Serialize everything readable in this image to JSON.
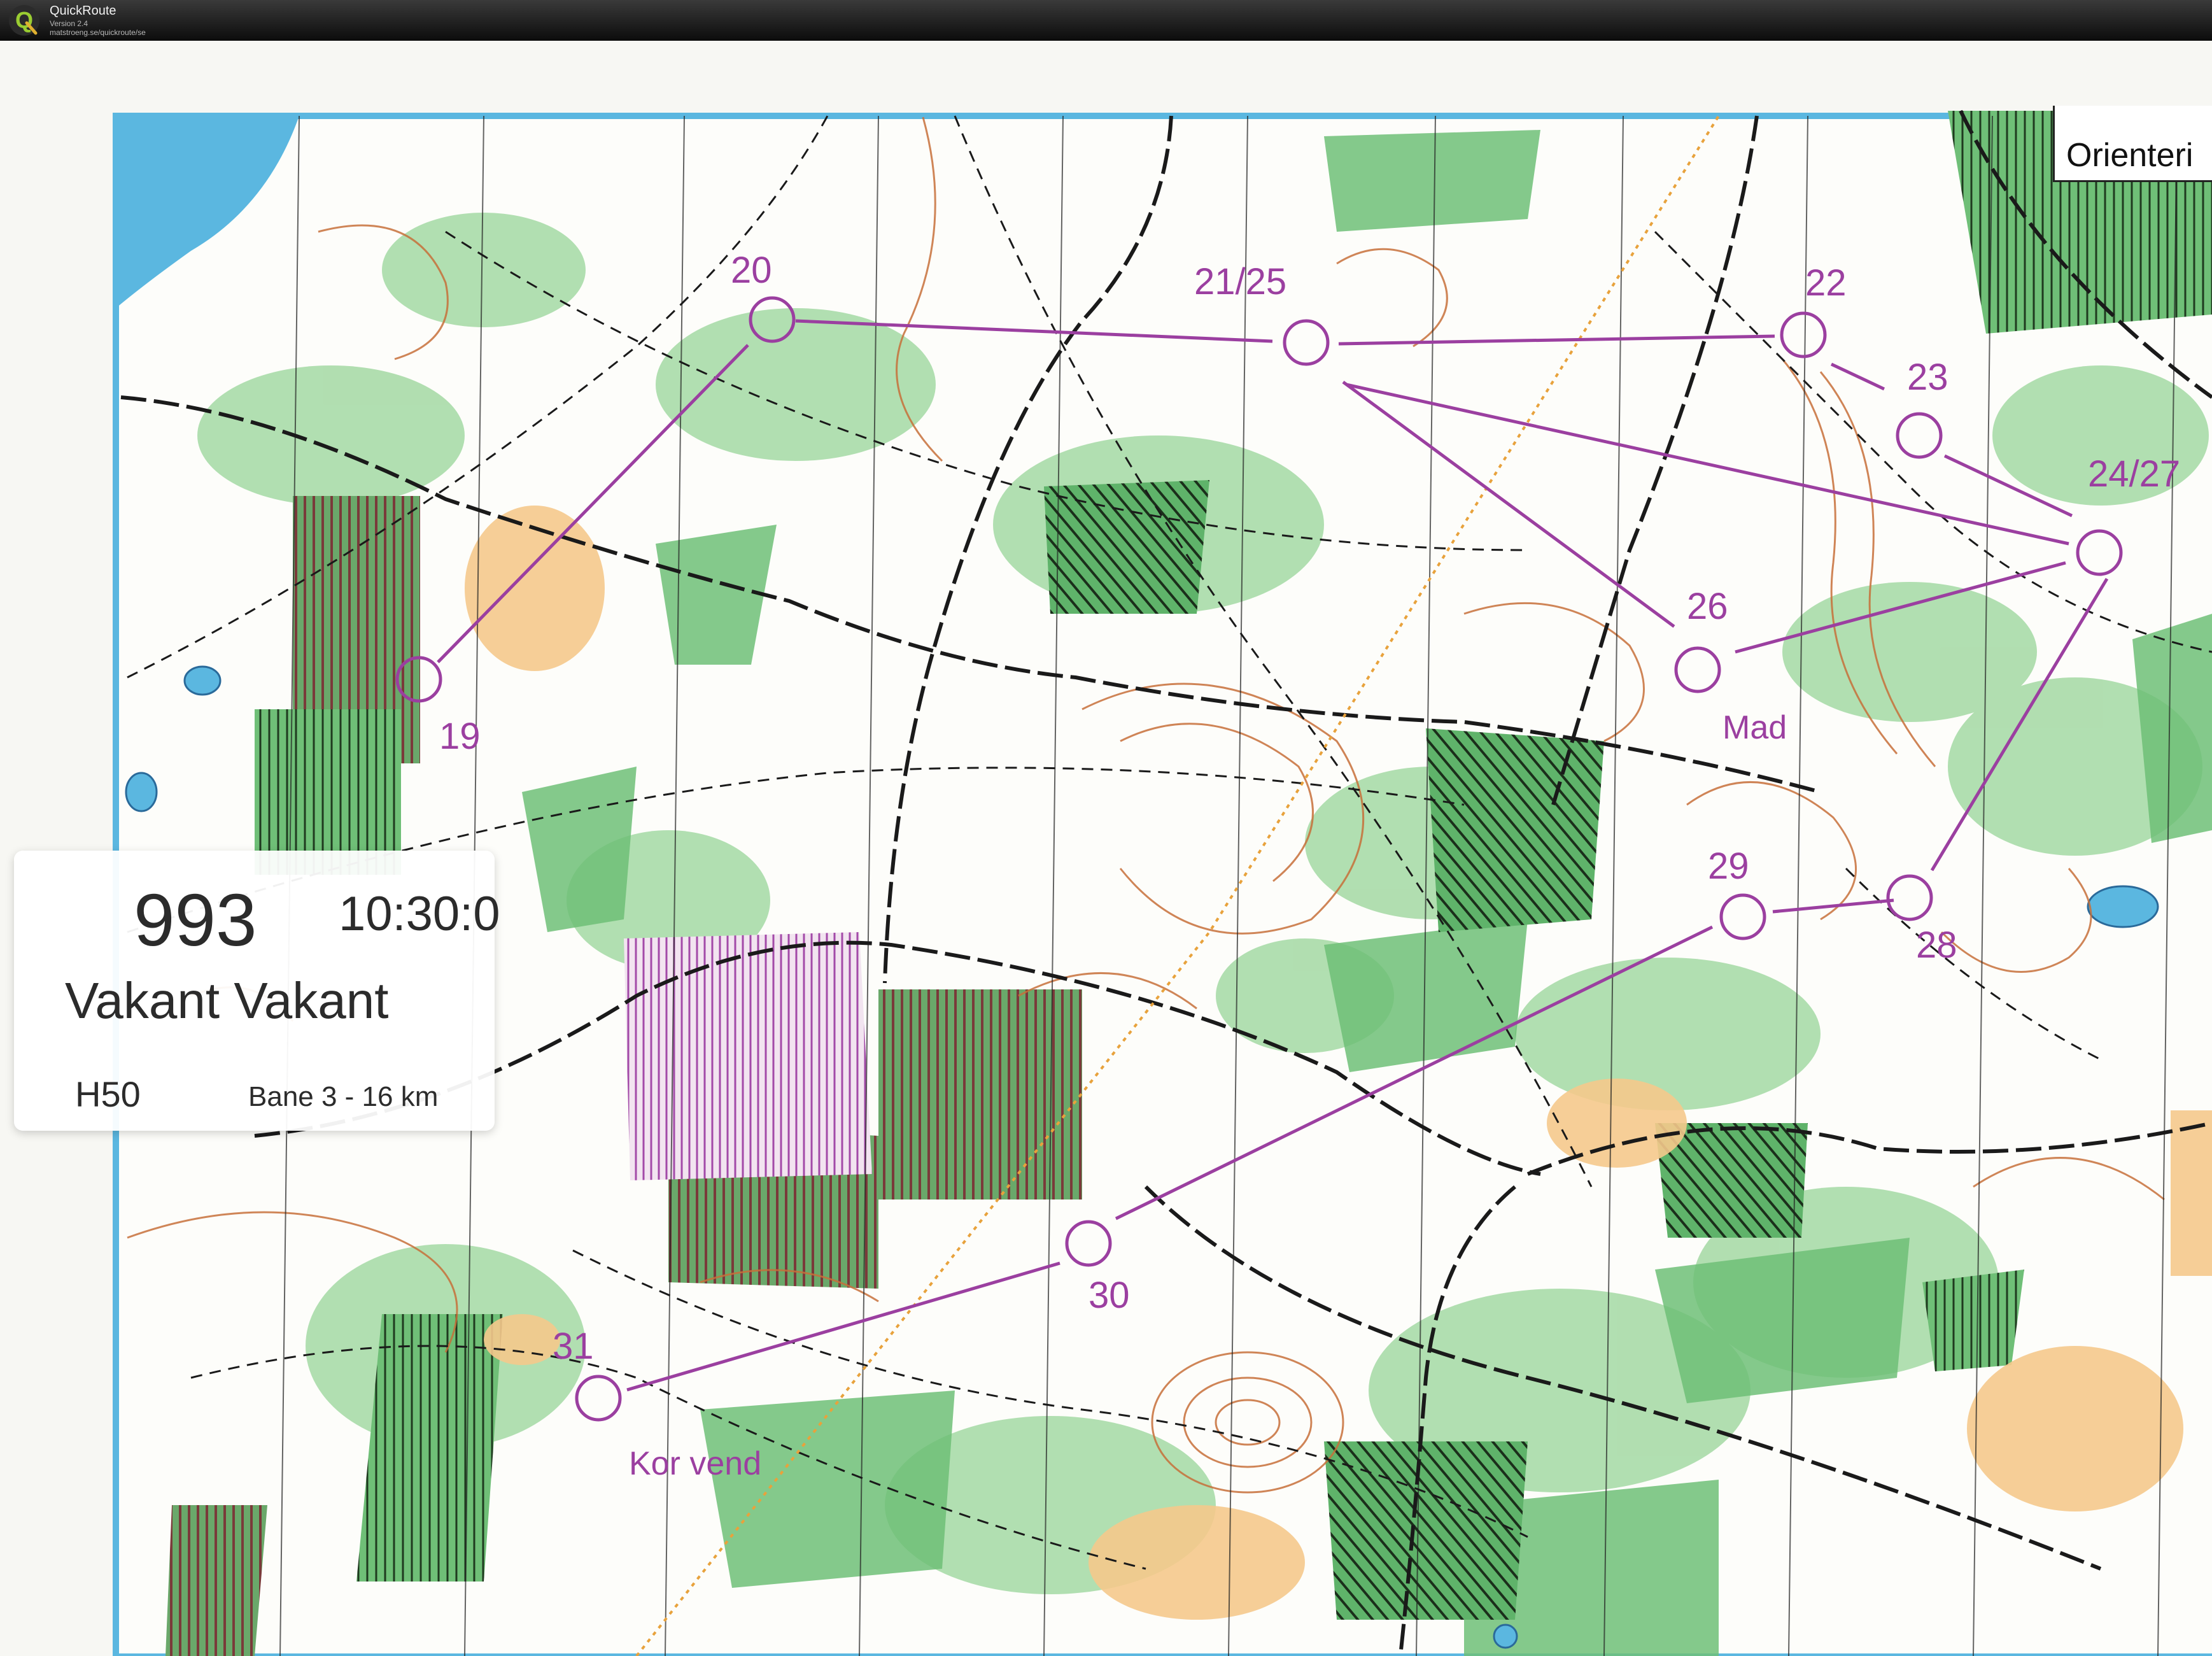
{
  "app": {
    "title": "QuickRoute",
    "version": "Version 2.4",
    "url": "matstroeng.se/quickroute/se"
  },
  "map": {
    "corner_label": "Orienteri",
    "colors": {
      "course": "#9b3fa0",
      "contour": "#c7703a",
      "green": "#79c27e",
      "dark_green": "#3f8f4a",
      "open": "#f5c98c",
      "water": "#5bb7e0",
      "path": "#222222"
    },
    "controls": [
      {
        "label": "19"
      },
      {
        "label": "20"
      },
      {
        "label": "21/25"
      },
      {
        "label": "22"
      },
      {
        "label": "23"
      },
      {
        "label": "24/27"
      },
      {
        "label": "26"
      },
      {
        "label": "28"
      },
      {
        "label": "29"
      },
      {
        "label": "30"
      },
      {
        "label": "31"
      }
    ],
    "annotations": {
      "mad": "Mad",
      "korvend": "Kor vend"
    }
  },
  "runner": {
    "bib": "993",
    "start_time": "10:30:0",
    "name": "Vakant Vakant",
    "class": "H50",
    "course": "Bane 3 - 16 km"
  }
}
